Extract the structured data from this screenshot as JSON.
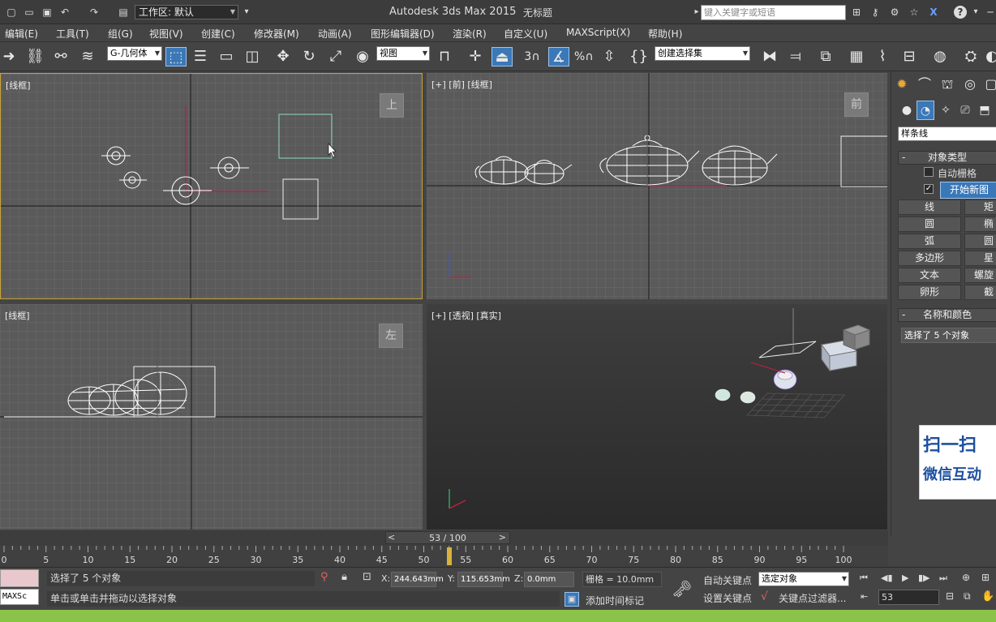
{
  "titlebar": {
    "workspace_label": "工作区: 默认",
    "app_title": "Autodesk 3ds Max  2015",
    "doc_title": "无标题",
    "search_placeholder": "键入关键字或短语"
  },
  "menu": [
    "编辑(E)",
    "工具(T)",
    "组(G)",
    "视图(V)",
    "创建(C)",
    "修改器(M)",
    "动画(A)",
    "图形编辑器(D)",
    "渲染(R)",
    "自定义(U)",
    "MAXScript(X)",
    "帮助(H)"
  ],
  "toolbar": {
    "filter_value": "G-几何体",
    "ref_coord_value": "视图",
    "snap_num": "3",
    "angle_label": "%",
    "named_sel_value": "创建选择集"
  },
  "viewports": {
    "top": {
      "label": "[线框]",
      "cube": "上"
    },
    "front": {
      "label": "[+] [前] [线框]",
      "cube": "前"
    },
    "left": {
      "label": "[线框]",
      "cube": "左"
    },
    "persp": {
      "label": "[+] [透视] [真实]"
    }
  },
  "axes": {
    "x": "x",
    "y": "y",
    "z": "z"
  },
  "right_panel": {
    "category_value": "样条线",
    "object_type_header": "对象类型",
    "auto_grid_label": "自动栅格",
    "start_new_shape": "开始新图",
    "buttons_left": [
      "线",
      "圆",
      "弧",
      "多边形",
      "文本",
      "卵形"
    ],
    "buttons_right": [
      "矩",
      "椭",
      "圆",
      "星",
      "螺旋",
      "截"
    ],
    "name_color_header": "名称和颜色",
    "name_field_value": "选择了 5 个对象",
    "header_minus": "-"
  },
  "qr_badge": {
    "line1": "扫一扫",
    "line2": "微信互动"
  },
  "timeline": {
    "frame_label": "53 / 100",
    "current_frame": 53,
    "max_frame": 100,
    "ticks": [
      "0",
      "5",
      "10",
      "15",
      "20",
      "25",
      "30",
      "35",
      "40",
      "45",
      "50",
      "55",
      "60",
      "65",
      "70",
      "75",
      "80",
      "85",
      "90",
      "95",
      "100"
    ],
    "prev": "<",
    "next": ">"
  },
  "status": {
    "maxscript_label": "MAXSc",
    "selection_text": "选择了 5 个对象",
    "prompt_text": "单击或单击并拖动以选择对象",
    "x_label": "X:",
    "x_value": "244.643mm",
    "y_label": "Y:",
    "y_value": "115.653mm",
    "z_label": "Z:",
    "z_value": "0.0mm",
    "grid_text": "栅格 = 10.0mm",
    "add_time_tag": "添加时间标记",
    "auto_key": "自动关键点",
    "set_key": "设置关键点",
    "selected_value": "选定对象",
    "key_filters": "关键点过滤器...",
    "frame_value": "53"
  },
  "colors": {
    "accent": "#3a78b8",
    "active_border": "#c8a236",
    "status_green": "#8bc34a"
  }
}
